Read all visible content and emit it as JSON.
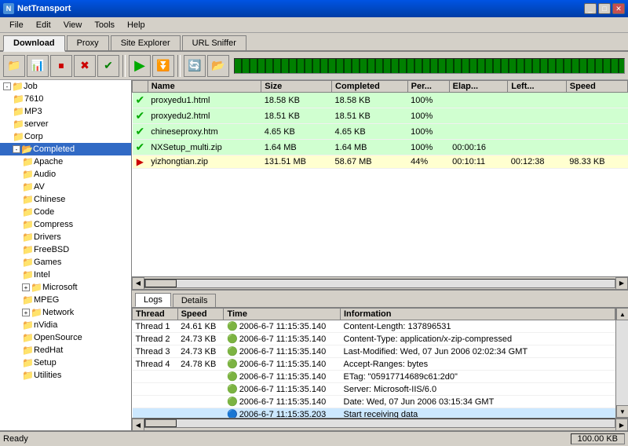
{
  "window": {
    "title": "NetTransport"
  },
  "menu": {
    "items": [
      "File",
      "Edit",
      "View",
      "Tools",
      "Help"
    ]
  },
  "tabs": {
    "items": [
      "Download",
      "Proxy",
      "Site Explorer",
      "URL Sniffer"
    ],
    "active": 0
  },
  "toolbar": {
    "buttons": [
      {
        "icon": "📁",
        "name": "open",
        "label": "Open"
      },
      {
        "icon": "📊",
        "name": "stats",
        "label": "Stats"
      },
      {
        "icon": "⏹",
        "name": "stop",
        "label": "Stop"
      },
      {
        "icon": "✖",
        "name": "delete",
        "label": "Delete"
      },
      {
        "icon": "✔",
        "name": "check",
        "label": "Check"
      }
    ],
    "action_buttons": [
      {
        "icon": "▶",
        "color": "#00aa00",
        "name": "start",
        "label": "Start"
      },
      {
        "icon": "⏸",
        "color": "#ffa000",
        "name": "pause",
        "label": "Pause"
      }
    ],
    "extra_buttons": [
      {
        "icon": "🔄",
        "name": "refresh",
        "label": "Refresh"
      },
      {
        "icon": "📂",
        "name": "folder",
        "label": "Folder"
      }
    ]
  },
  "sidebar": {
    "items": [
      {
        "label": "Job",
        "indent": 0,
        "expand": "-",
        "type": "folder"
      },
      {
        "label": "7610",
        "indent": 1,
        "type": "folder"
      },
      {
        "label": "MP3",
        "indent": 1,
        "type": "folder"
      },
      {
        "label": "server",
        "indent": 1,
        "type": "folder"
      },
      {
        "label": "Corp",
        "indent": 1,
        "type": "folder"
      },
      {
        "label": "Completed",
        "indent": 1,
        "expand": "-",
        "type": "folder",
        "selected": true
      },
      {
        "label": "Apache",
        "indent": 2,
        "type": "folder"
      },
      {
        "label": "Audio",
        "indent": 2,
        "type": "folder"
      },
      {
        "label": "AV",
        "indent": 2,
        "type": "folder"
      },
      {
        "label": "Chinese",
        "indent": 2,
        "type": "folder"
      },
      {
        "label": "Code",
        "indent": 2,
        "type": "folder"
      },
      {
        "label": "Compress",
        "indent": 2,
        "type": "folder"
      },
      {
        "label": "Drivers",
        "indent": 2,
        "type": "folder"
      },
      {
        "label": "FreeBSD",
        "indent": 2,
        "type": "folder"
      },
      {
        "label": "Games",
        "indent": 2,
        "type": "folder"
      },
      {
        "label": "Intel",
        "indent": 2,
        "type": "folder"
      },
      {
        "label": "Microsoft",
        "indent": 2,
        "expand": "+",
        "type": "folder"
      },
      {
        "label": "MPEG",
        "indent": 2,
        "type": "folder"
      },
      {
        "label": "Network",
        "indent": 2,
        "expand": "+",
        "type": "folder"
      },
      {
        "label": "nVidia",
        "indent": 2,
        "type": "folder"
      },
      {
        "label": "OpenSource",
        "indent": 2,
        "type": "folder"
      },
      {
        "label": "RedHat",
        "indent": 2,
        "type": "folder"
      },
      {
        "label": "Setup",
        "indent": 2,
        "type": "folder"
      },
      {
        "label": "Utilities",
        "indent": 2,
        "type": "folder"
      }
    ]
  },
  "file_list": {
    "columns": [
      "",
      "Name",
      "Size",
      "Completed",
      "Per...",
      "Elap...",
      "Left...",
      "Speed"
    ],
    "rows": [
      {
        "status": "done",
        "name": "proxyedu1.html",
        "size": "18.58 KB",
        "completed": "18.58 KB",
        "percent": "100%",
        "elapsed": "",
        "left": "",
        "speed": "",
        "row_class": "row-completed"
      },
      {
        "status": "done",
        "name": "proxyedu2.html",
        "size": "18.51 KB",
        "completed": "18.51 KB",
        "percent": "100%",
        "elapsed": "",
        "left": "",
        "speed": "",
        "row_class": "row-completed"
      },
      {
        "status": "done",
        "name": "chineseproxy.htm",
        "size": "4.65 KB",
        "completed": "4.65 KB",
        "percent": "100%",
        "elapsed": "",
        "left": "",
        "speed": "",
        "row_class": "row-completed"
      },
      {
        "status": "done",
        "name": "NXSetup_multi.zip",
        "size": "1.64 MB",
        "completed": "1.64 MB",
        "percent": "100%",
        "elapsed": "00:00:16",
        "left": "",
        "speed": "",
        "row_class": "row-completed"
      },
      {
        "status": "active",
        "name": "yizhongtian.zip",
        "size": "131.51 MB",
        "completed": "58.67 MB",
        "percent": "44%",
        "elapsed": "00:10:11",
        "left": "00:12:38",
        "speed": "98.33 KB",
        "row_class": "row-inprogress"
      }
    ]
  },
  "log_tabs": {
    "items": [
      "Logs",
      "Details"
    ],
    "active": 0
  },
  "log": {
    "columns": [
      "Thread",
      "Speed",
      "Time",
      "Information"
    ],
    "rows": [
      {
        "thread": "Thread 1",
        "speed": "24.61 KB",
        "time": "2006-6-7 11:15:35.140",
        "info": "Content-Length: 137896531",
        "highlight": false
      },
      {
        "thread": "Thread 2",
        "speed": "24.73 KB",
        "time": "2006-6-7 11:15:35.140",
        "info": "Content-Type: application/x-zip-compressed",
        "highlight": false
      },
      {
        "thread": "Thread 3",
        "speed": "24.73 KB",
        "time": "2006-6-7 11:15:35.140",
        "info": "Last-Modified: Wed, 07 Jun 2006 02:02:34 GMT",
        "highlight": false
      },
      {
        "thread": "Thread 4",
        "speed": "24.78 KB",
        "time": "2006-6-7 11:15:35.140",
        "info": "Accept-Ranges: bytes",
        "highlight": false
      },
      {
        "thread": "",
        "speed": "",
        "time": "2006-6-7 11:15:35.140",
        "info": "ETag: \"05917714689c61:2d0\"",
        "highlight": false
      },
      {
        "thread": "",
        "speed": "",
        "time": "2006-6-7 11:15:35.140",
        "info": "Server: Microsoft-IIS/6.0",
        "highlight": false
      },
      {
        "thread": "",
        "speed": "",
        "time": "2006-6-7 11:15:35.140",
        "info": "Date: Wed, 07 Jun 2006 03:15:34 GMT",
        "highlight": false
      },
      {
        "thread": "",
        "speed": "",
        "time": "2006-6-7 11:15:35.203",
        "info": "Start receiving data",
        "highlight": true
      }
    ]
  },
  "status_bar": {
    "left": "Ready",
    "right": "100.00 KB"
  }
}
